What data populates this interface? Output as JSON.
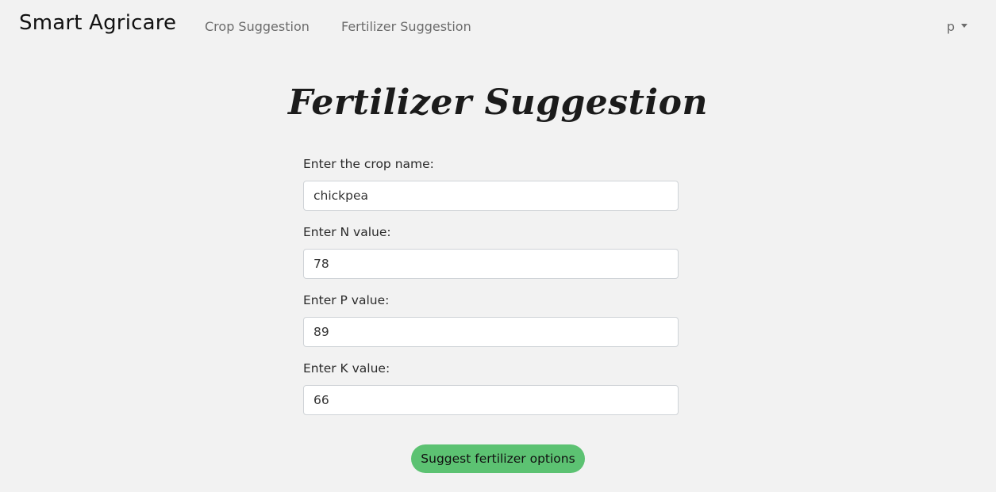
{
  "navbar": {
    "brand": "Smart Agricare",
    "links": [
      {
        "label": "Crop Suggestion"
      },
      {
        "label": "Fertilizer Suggestion"
      }
    ],
    "user": {
      "label": "p",
      "icon": "caret-down-icon"
    }
  },
  "page": {
    "title": "Fertilizer Suggestion"
  },
  "form": {
    "fields": [
      {
        "label": "Enter the crop name:",
        "value": "chickpea"
      },
      {
        "label": "Enter N value:",
        "value": "78"
      },
      {
        "label": "Enter P value:",
        "value": "89"
      },
      {
        "label": "Enter K value:",
        "value": "66"
      }
    ],
    "submit_label": "Suggest fertilizer options"
  },
  "colors": {
    "background": "#f2f2f2",
    "button": "#5cc272",
    "nav_text": "#6c6c6c"
  }
}
